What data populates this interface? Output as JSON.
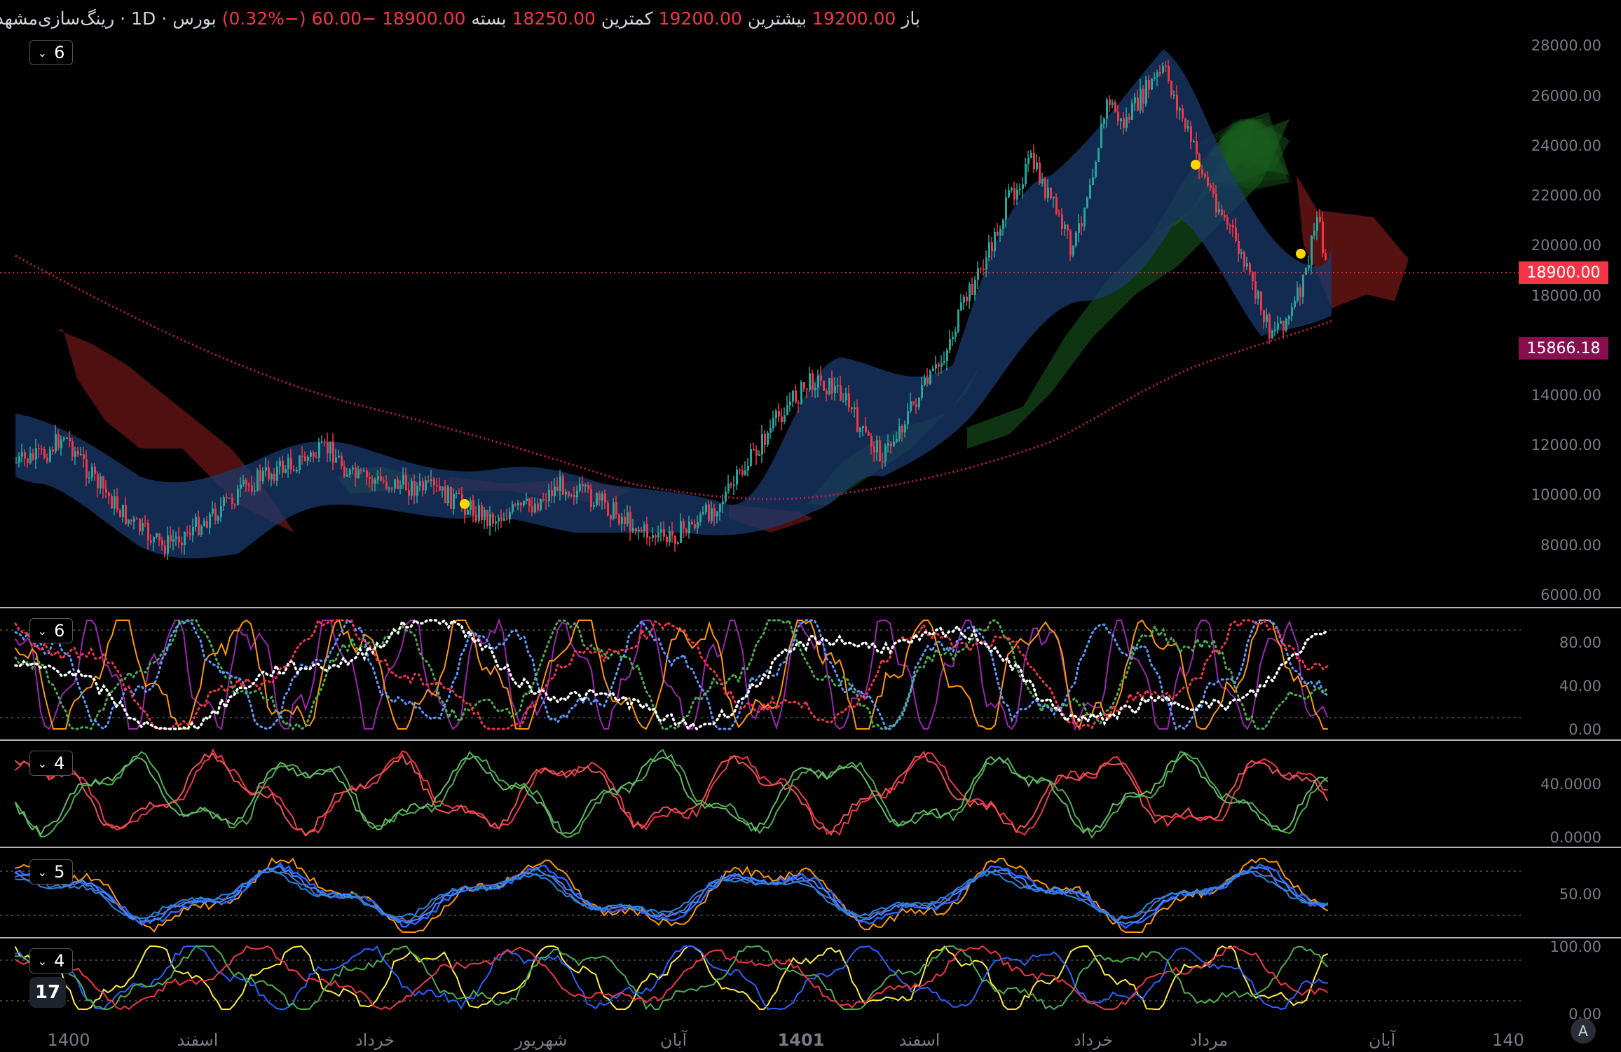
{
  "legend": {
    "symbol": "رینگ‌سازی‌مشهد",
    "interval": "1D",
    "exchange": "بورس",
    "open_label": "باز",
    "open_value": "19200.00",
    "high_label": "بیشترین",
    "high_value": "19200.00",
    "low_label": "کمترین",
    "low_value": "18250.00",
    "close_label": "بسته",
    "close_value": "18900.00",
    "change_value": "−60.00",
    "change_pct": "(−0.32%)"
  },
  "pane_buttons": [
    "6",
    "6",
    "4",
    "5",
    "4"
  ],
  "price_tags": {
    "last_price": "18900.00",
    "last_price_color": "#f23645",
    "ma_value": "15866.18",
    "ma_color": "#880e4f"
  },
  "price_axis": [
    "28000.00",
    "26000.00",
    "24000.00",
    "22000.00",
    "20000.00",
    "18000.00",
    "14000.00",
    "12000.00",
    "10000.00",
    "8000.00",
    "6000.00"
  ],
  "osc1_axis": [
    "80.00",
    "40.00",
    "0.00"
  ],
  "osc2_axis": [
    "40.0000",
    "0.0000"
  ],
  "osc3_axis": [
    "50.00"
  ],
  "osc4_axis": [
    "100.00",
    "0.00"
  ],
  "time_axis": [
    "1400",
    "اسفند",
    "خرداد",
    "شهریور",
    "آبان",
    "1401",
    "اسفند",
    "خرداد",
    "مرداد",
    "آبان",
    "140"
  ],
  "auto_button": "A",
  "logo_text": "17",
  "colors": {
    "up": "#26a69a",
    "down": "#f23645",
    "cloud_bull": "#1b5e20",
    "cloud_bear": "#6b1515",
    "band": "#1a3a6b",
    "ma": "#c2185b"
  },
  "chart_data": {
    "type": "candlestick",
    "price_range": [
      6000,
      28000
    ],
    "last_close": 18900,
    "ma_last": 15866.18,
    "osc_ranges": {
      "osc1": [
        0,
        100
      ],
      "osc2": [
        0,
        60
      ],
      "osc3": [
        0,
        80
      ],
      "osc4": [
        0,
        100
      ]
    }
  }
}
